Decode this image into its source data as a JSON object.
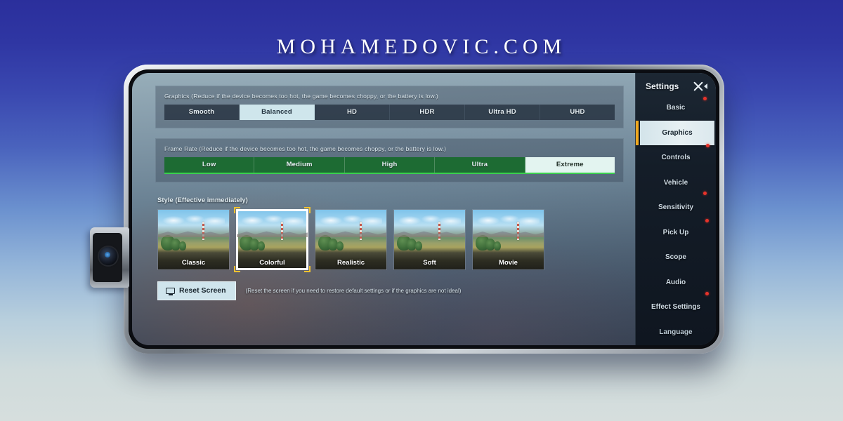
{
  "watermark": {
    "text": "MOHAMEDOVIC.COM"
  },
  "device": {
    "type": "smartphone-landscape",
    "camera": "pop-up-selfie-camera",
    "frame_color": "#b9bfc6"
  },
  "game_settings": {
    "graphics": {
      "label": "Graphics (Reduce if the device becomes too hot, the game becomes choppy, or the battery is low.)",
      "options": [
        "Smooth",
        "Balanced",
        "HD",
        "HDR",
        "Ultra HD",
        "UHD"
      ],
      "selected": "Balanced"
    },
    "frame_rate": {
      "label": "Frame Rate (Reduce if the device becomes too hot, the game becomes choppy, or the battery is low.)",
      "options": [
        "Low",
        "Medium",
        "High",
        "Ultra",
        "Extreme"
      ],
      "selected": "Extreme",
      "accent": "#1d6b33",
      "accent_edge": "#3ad04e"
    },
    "style": {
      "label": "Style (Effective immediately)",
      "options": [
        "Classic",
        "Colorful",
        "Realistic",
        "Soft",
        "Movie"
      ],
      "selected": "Colorful",
      "selection_bracket_color": "#f2c230"
    },
    "reset": {
      "button_label": "Reset Screen",
      "icon": "monitor-icon",
      "hint": "(Reset the screen if you need to restore default settings or if the graphics are not ideal)"
    }
  },
  "sidebar": {
    "title": "Settings",
    "close_icon": "close-x-icon",
    "collapse_icon": "caret-left-icon",
    "active_accent": "#f0a81e",
    "badge_color": "#e8332a",
    "items": [
      {
        "label": "Basic",
        "active": false,
        "badge": true
      },
      {
        "label": "Graphics",
        "active": true,
        "badge": true
      },
      {
        "label": "Controls",
        "active": false,
        "badge": false
      },
      {
        "label": "Vehicle",
        "active": false,
        "badge": true
      },
      {
        "label": "Sensitivity",
        "active": false,
        "badge": false
      },
      {
        "label": "Pick Up",
        "active": false,
        "badge": true
      },
      {
        "label": "Scope",
        "active": false,
        "badge": false
      },
      {
        "label": "Audio",
        "active": false,
        "badge": true
      },
      {
        "label": "Effect Settings",
        "active": false,
        "badge": false
      },
      {
        "label": "Language",
        "active": false,
        "badge": false
      }
    ]
  }
}
